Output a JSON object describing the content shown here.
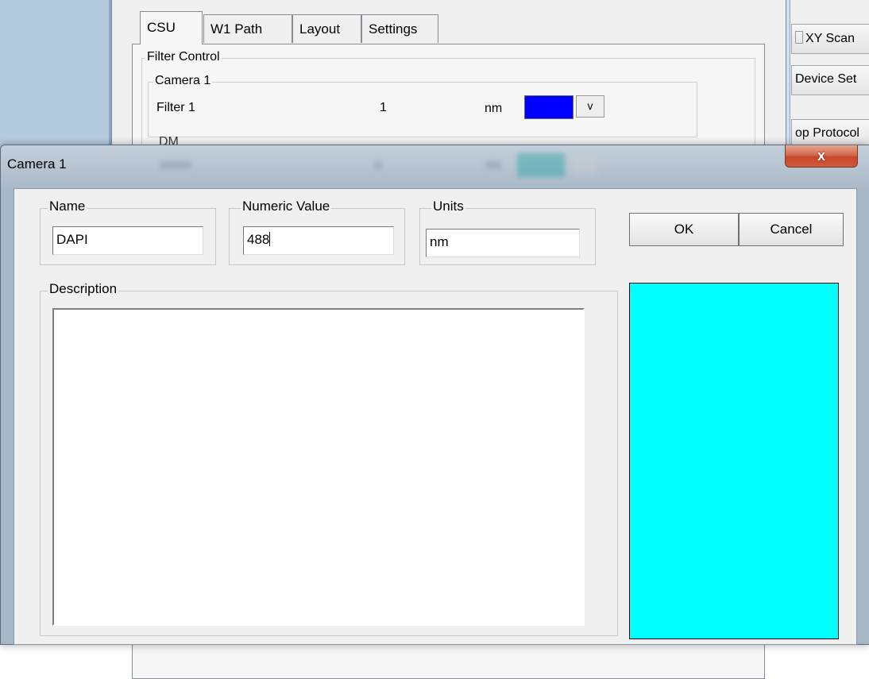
{
  "background_window": {
    "tabs": [
      "CSU",
      "W1 Path",
      "Layout",
      "Settings"
    ],
    "filter_control_label": "Filter Control",
    "camera1_group_label": "Camera 1",
    "filter_row": {
      "label": "Filter 1",
      "value": "1",
      "unit": "nm",
      "swatch_color": "#0000ff",
      "dropdown_label": "v"
    },
    "dm_group_label": "DM",
    "side_buttons": [
      "XY Scan",
      "Device Set",
      "op Protocol"
    ]
  },
  "dialog": {
    "title": "Camera 1",
    "close_label": "x",
    "name_label": "Name",
    "name_value": "DAPI",
    "numeric_label": "Numeric Value",
    "numeric_value": "488",
    "units_label": "Units",
    "units_value": "nm",
    "ok_label": "OK",
    "cancel_label": "Cancel",
    "description_label": "Description",
    "description_value": "",
    "color_preview": "#00ffff"
  }
}
